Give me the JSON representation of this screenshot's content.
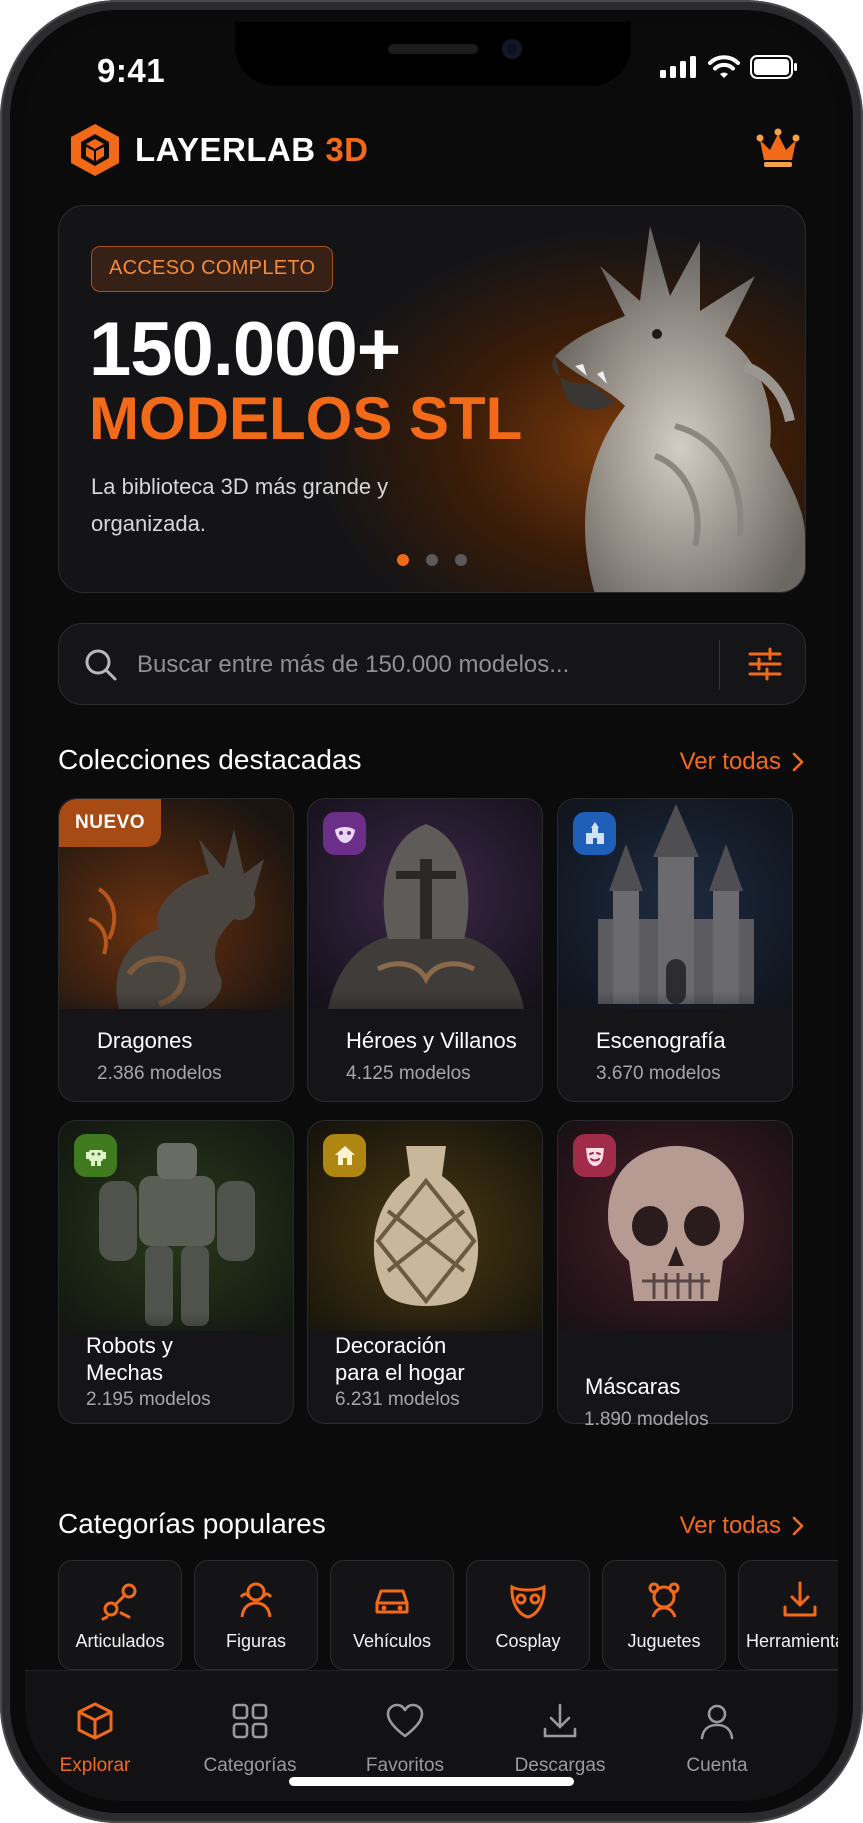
{
  "status_bar": {
    "time": "9:41"
  },
  "brand": {
    "name": "LAYERLAB",
    "accent": "3D"
  },
  "hero": {
    "badge": "ACCESO COMPLETO",
    "title": "150.000+",
    "subtitle": "MODELOS STL",
    "description": "La biblioteca 3D más grande y organizada.",
    "slides_total": 3,
    "active_slide": 1
  },
  "search": {
    "placeholder": "Buscar entre más de 150.000 modelos..."
  },
  "featured": {
    "title": "Colecciones destacadas",
    "see_all": "Ver todas",
    "new_badge": "NUEVO",
    "collections": [
      {
        "name": "Dragones",
        "count": "2.386 modelos",
        "icon": "dragon-icon",
        "color": "#f26a18"
      },
      {
        "name": "Héroes y Villanos",
        "count": "4.125 modelos",
        "icon": "mask-hero-icon",
        "color": "#6b2f8a"
      },
      {
        "name": "Escenografía",
        "count": "3.670 modelos",
        "icon": "castle-icon",
        "color": "#1f5fb8"
      },
      {
        "name": "Robots y\nMechas",
        "count": "2.195 modelos",
        "icon": "robot-icon",
        "color": "#3f7a1f"
      },
      {
        "name": "Decoración\npara el hogar",
        "count": "6.231 modelos",
        "icon": "home-icon",
        "color": "#b08612"
      },
      {
        "name": "Máscaras",
        "count": "1.890 modelos",
        "icon": "theater-mask-icon",
        "color": "#a12c4a"
      }
    ]
  },
  "popular": {
    "title": "Categorías populares",
    "see_all": "Ver todas",
    "categories": [
      {
        "label": "Articulados",
        "icon": "articulated-icon"
      },
      {
        "label": "Figuras",
        "icon": "figure-icon"
      },
      {
        "label": "Vehículos",
        "icon": "car-icon"
      },
      {
        "label": "Cosplay",
        "icon": "cosplay-mask-icon"
      },
      {
        "label": "Juguetes",
        "icon": "toy-icon"
      },
      {
        "label": "Herramientas",
        "icon": "tool-icon"
      }
    ]
  },
  "tabbar": {
    "items": [
      {
        "label": "Explorar",
        "icon": "cube-icon",
        "active": true
      },
      {
        "label": "Categorías",
        "icon": "grid-icon",
        "active": false
      },
      {
        "label": "Favoritos",
        "icon": "heart-icon",
        "active": false
      },
      {
        "label": "Descargas",
        "icon": "download-icon",
        "active": false
      },
      {
        "label": "Cuenta",
        "icon": "user-icon",
        "active": false
      }
    ]
  },
  "colors": {
    "accent": "#f26a18",
    "background": "#0b0b0c",
    "card": "#151517"
  }
}
